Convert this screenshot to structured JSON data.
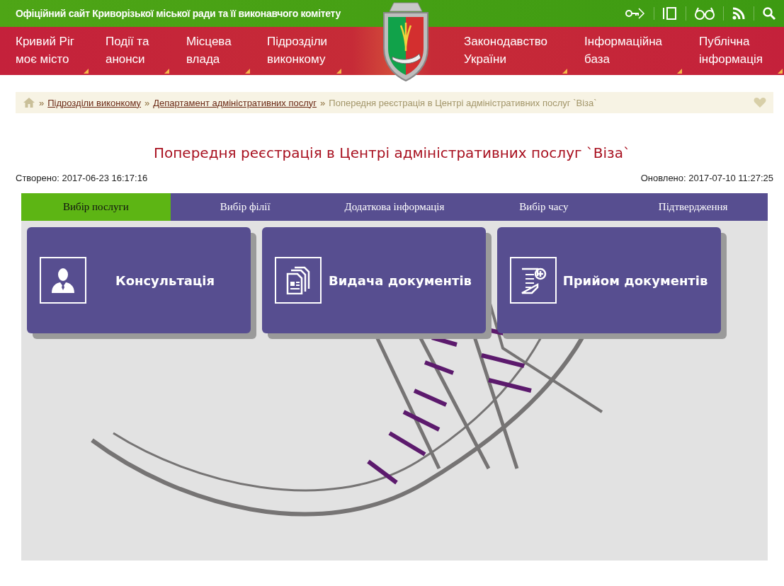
{
  "header": {
    "site_title": "Офіційний сайт Криворізької міської ради та її виконавчого комітету"
  },
  "nav_left": [
    "Кривий Ріг\nмоє місто",
    "Події та\nанонси",
    "Місцева\nвлада",
    "Підрозділи\nвиконкому"
  ],
  "nav_right": [
    "Законодавство\nУкраїни",
    "Інформаційна\nбаза",
    "Публічна\nінформація"
  ],
  "breadcrumb": {
    "separators": [
      "»",
      "»",
      "»"
    ],
    "links": [
      "Підрозділи виконкому",
      "Департамент адміністративних послуг"
    ],
    "current": "Попередня реєстрація в Центрі адміністративних послуг `Віза`"
  },
  "page_title": "Попередня реєстрація в Центрі адміністративних послуг `Віза`",
  "created": "Створено: 2017-06-23 16:17:16",
  "updated": "Оновлено: 2017-07-10 11:27:25",
  "steps": [
    {
      "label": "Вибір послуги",
      "selected": true
    },
    {
      "label": "Вибір філії",
      "selected": false
    },
    {
      "label": "Додаткова інформація",
      "selected": false
    },
    {
      "label": "Вибір часу",
      "selected": false
    },
    {
      "label": "Підтвердження",
      "selected": false
    }
  ],
  "services": [
    {
      "kind": "person",
      "label": "Консультація"
    },
    {
      "kind": "documents",
      "label": "Видача документів"
    },
    {
      "kind": "add-document",
      "label": "Прийом документів"
    }
  ]
}
